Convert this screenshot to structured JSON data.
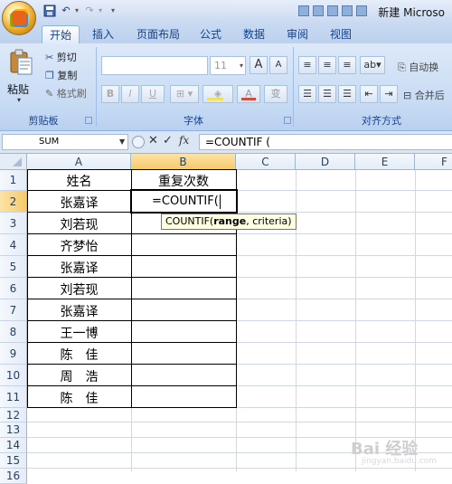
{
  "window_title": "新建 Microso",
  "tabs": [
    "开始",
    "插入",
    "页面布局",
    "公式",
    "数据",
    "审阅",
    "视图"
  ],
  "active_tab_index": 0,
  "clipboard": {
    "paste_label": "粘贴",
    "cut_label": "剪切",
    "copy_label": "复制",
    "format_painter_label": "格式刷",
    "group_label": "剪贴板"
  },
  "font_group": {
    "font_size": "11",
    "bold": "B",
    "italic": "I",
    "underline": "U",
    "font_color_letter": "A",
    "phonetic": "变",
    "grow": "A",
    "shrink": "A",
    "group_label": "字体"
  },
  "alignment_group": {
    "wrap_text_label": "自动换",
    "merge_center_label": "合并后",
    "group_label": "对齐方式"
  },
  "formula_bar": {
    "name_box": "SUM",
    "cancel": "✕",
    "enter": "✓",
    "fx": "fx",
    "content": "=COUNTIF ("
  },
  "columns": [
    "A",
    "B",
    "C",
    "D",
    "E",
    "F"
  ],
  "rows": [
    "1",
    "2",
    "3",
    "4",
    "5",
    "6",
    "7",
    "8",
    "9",
    "10",
    "11",
    "12",
    "13",
    "14",
    "15",
    "16"
  ],
  "cells": {
    "A1": "姓名",
    "B1": "重复次数",
    "A2": "张嘉译",
    "A3": "刘若现",
    "A4": "齐梦怡",
    "A5": "张嘉译",
    "A6": "刘若现",
    "A7": "张嘉译",
    "A8": "王一博",
    "A9": "陈　佳",
    "A10": "周　浩",
    "A11": "陈　佳"
  },
  "editing_cell": "B2",
  "editing_text": "=COUNTIF(",
  "tooltip": {
    "func": "COUNTIF(",
    "arg_active": "range",
    "rest": ", criteria)"
  },
  "watermark": {
    "main": "Bai 经验",
    "sub": "jingyan.baidu.com"
  }
}
